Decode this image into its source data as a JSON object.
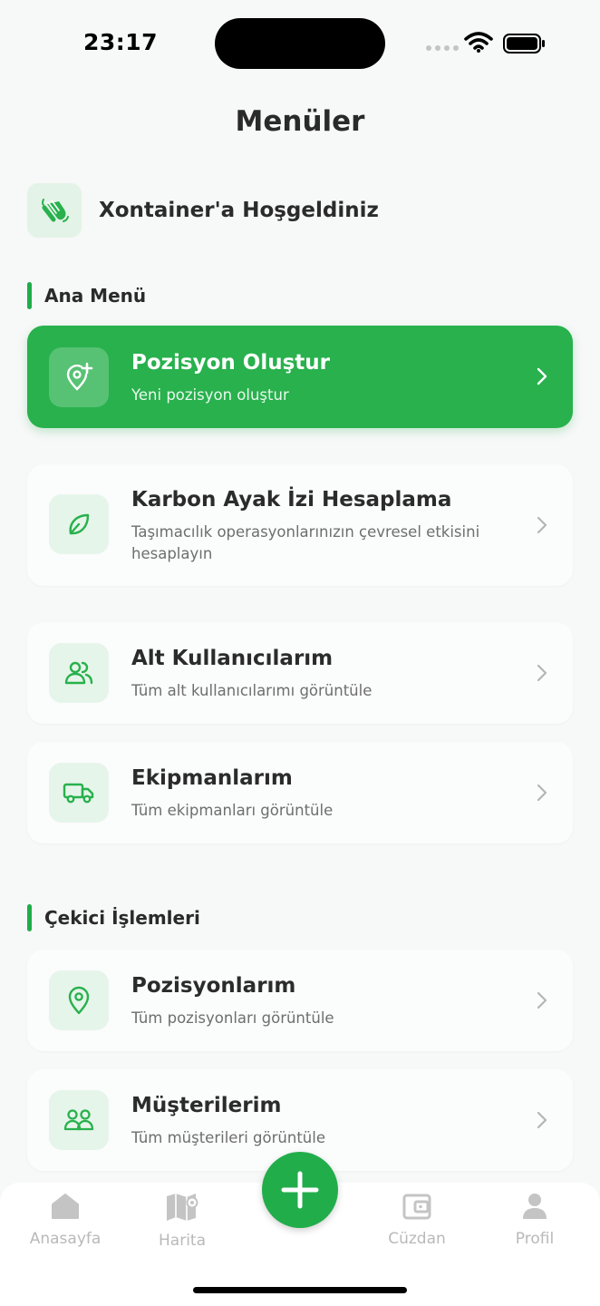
{
  "status_bar": {
    "time": "23:17"
  },
  "header": {
    "title": "Menüler"
  },
  "welcome": {
    "text": "Xontainer'a Hoşgeldiniz",
    "icon": "waving-hand-icon"
  },
  "sections": {
    "main": {
      "title": "Ana Menü"
    },
    "tow": {
      "title": "Çekici İşlemleri"
    }
  },
  "menu": {
    "create_position": {
      "title": "Pozisyon Oluştur",
      "subtitle": "Yeni pozisyon oluştur",
      "icon": "map-pin-plus-icon"
    },
    "carbon": {
      "title": "Karbon Ayak İzi Hesaplama",
      "subtitle": "Taşımacılık operasyonlarınızın çevresel etkisini hesaplayın",
      "icon": "leaf-icon"
    },
    "sub_users": {
      "title": "Alt Kullanıcılarım",
      "subtitle": "Tüm alt kullanıcılarımı görüntüle",
      "icon": "users-icon"
    },
    "equipment": {
      "title": "Ekipmanlarım",
      "subtitle": "Tüm ekipmanları görüntüle",
      "icon": "truck-icon"
    },
    "positions": {
      "title": "Pozisyonlarım",
      "subtitle": "Tüm pozisyonları görüntüle",
      "icon": "map-pin-icon"
    },
    "customers": {
      "title": "Müşterilerim",
      "subtitle": "Tüm müşterileri görüntüle",
      "icon": "group-icon"
    }
  },
  "bottom_nav": {
    "home": "Anasayfa",
    "map": "Harita",
    "wallet": "Cüzdan",
    "profile": "Profil",
    "fab_icon": "plus-icon"
  },
  "colors": {
    "accent": "#28b14d",
    "icon_bg": "#e6f5ea",
    "inactive": "#b9b9b9"
  }
}
